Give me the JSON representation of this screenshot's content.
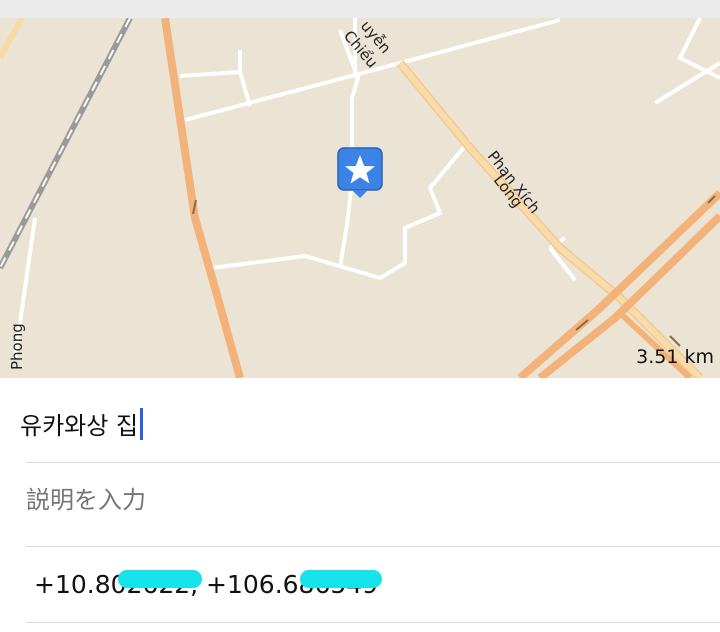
{
  "map": {
    "street_labels": {
      "nguyen_chieu_top": "uyễn",
      "nguyen_chieu_bottom": "Chiểu",
      "phan_xich_long_1": "Phan Xích",
      "phan_xich_long_2": "Long",
      "phong": "Phong"
    },
    "scale": "3.51 km",
    "pin_icon": "star-pin-icon",
    "colors": {
      "background": "#ebe3d3",
      "major_road": "#f4b27b",
      "secondary_road": "#f7d9a3",
      "minor_road": "#ffffff",
      "rail": "#9a9a9a",
      "pin": "#3c83e6"
    }
  },
  "form": {
    "name_value": "유카와상 집",
    "description_placeholder": "説明を入力",
    "coordinates_text": "+10.802622, +106.686549"
  }
}
